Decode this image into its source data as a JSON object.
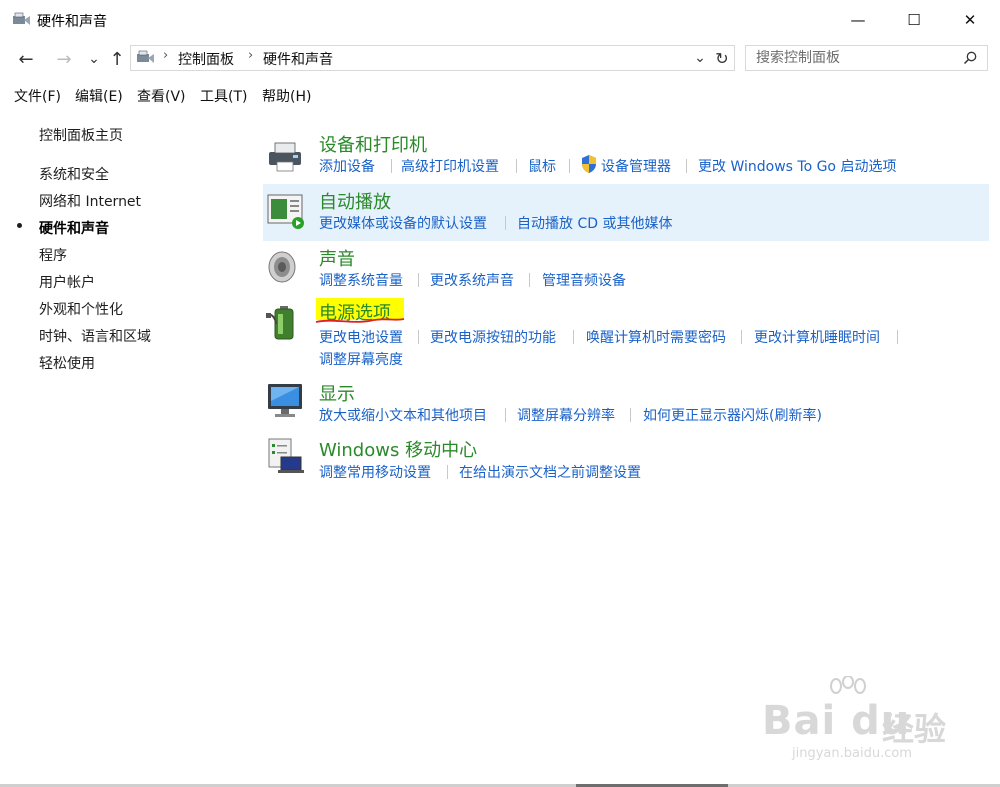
{
  "window": {
    "title": "硬件和声音",
    "minimize": "—",
    "maximize": "☐",
    "close": "✕"
  },
  "nav": {
    "back": "←",
    "forward": "→",
    "recent": "⌄",
    "up": "↑",
    "dropdown": "⌄",
    "refresh": "↻"
  },
  "breadcrumb": {
    "items": [
      "控制面板",
      "硬件和声音"
    ],
    "separator": "›"
  },
  "search": {
    "placeholder": "搜索控制面板",
    "icon": "search-icon"
  },
  "menu": [
    "文件(F)",
    "编辑(E)",
    "查看(V)",
    "工具(T)",
    "帮助(H)"
  ],
  "sidebar": {
    "home": "控制面板主页",
    "items": [
      "系统和安全",
      "网络和 Internet",
      "硬件和声音",
      "程序",
      "用户帐户",
      "外观和个性化",
      "时钟、语言和区域",
      "轻松使用"
    ],
    "active_index": 2
  },
  "categories": [
    {
      "title": "设备和打印机",
      "icon": "printer-icon",
      "links": [
        "添加设备",
        "高级打印机设置",
        "鼠标",
        "设备管理器",
        "更改 Windows To Go 启动选项"
      ]
    },
    {
      "title": "自动播放",
      "icon": "autoplay-icon",
      "links": [
        "更改媒体或设备的默认设置",
        "自动播放 CD 或其他媒体"
      ]
    },
    {
      "title": "声音",
      "icon": "speaker-icon",
      "links": [
        "调整系统音量",
        "更改系统声音",
        "管理音频设备"
      ]
    },
    {
      "title": "电源选项",
      "icon": "battery-icon",
      "links": [
        "更改电池设置",
        "更改电源按钮的功能",
        "唤醒计算机时需要密码",
        "更改计算机睡眠时间",
        "调整屏幕亮度"
      ]
    },
    {
      "title": "显示",
      "icon": "monitor-icon",
      "links": [
        "放大或缩小文本和其他项目",
        "调整屏幕分辨率",
        "如何更正显示器闪烁(刷新率)"
      ]
    },
    {
      "title": "Windows 移动中心",
      "icon": "mobility-center-icon",
      "links": [
        "调整常用移动设置",
        "在给出演示文档之前调整设置"
      ]
    }
  ],
  "colors": {
    "category_title": "#2a8a2a",
    "link": "#1a62c7",
    "hover_bg": "#e5f1fb",
    "highlight": "#ffff00",
    "annotation": "#e02020"
  },
  "watermark": {
    "brand": "Bai du",
    "suffix": "经验",
    "url": "jingyan.baidu.com"
  }
}
